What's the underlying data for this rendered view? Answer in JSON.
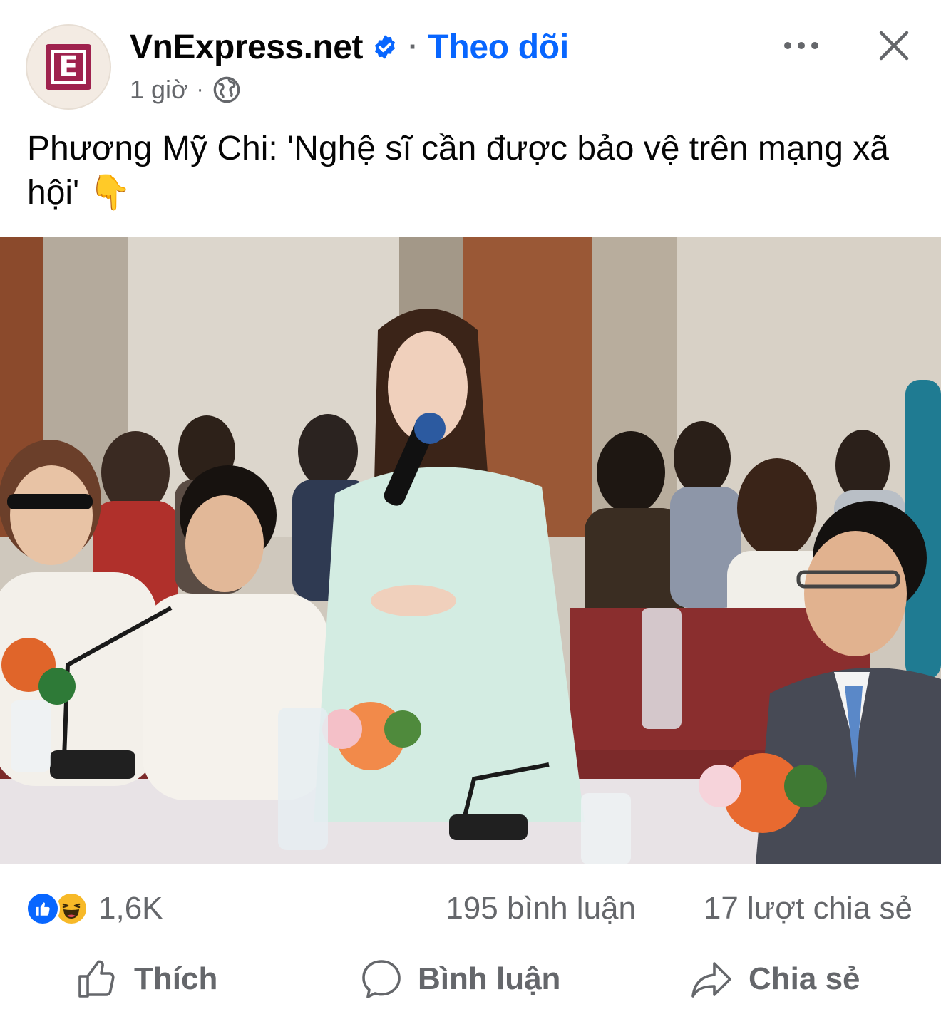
{
  "post": {
    "page_name": "VnExpress.net",
    "follow_label": "Theo dõi",
    "time": "1 giờ",
    "icons": {
      "avatar": "vnexpress-logo-icon",
      "verified": "verified-badge-icon",
      "audience": "globe-icon",
      "more": "more-horizontal-icon",
      "close": "close-icon"
    },
    "caption": "Phương Mỹ Chi: 'Nghệ sĩ cần được bảo vệ trên mạng xã hội' 👇",
    "colors": {
      "brand": "#9f224e",
      "accent": "#0866ff",
      "secondary_text": "#65676b"
    }
  },
  "stats": {
    "reaction_icons": [
      "like-reaction-icon",
      "haha-reaction-icon"
    ],
    "reactions_count": "1,6K",
    "comments": "195 bình luận",
    "shares": "17 lượt chia sẻ"
  },
  "actions": {
    "like": {
      "label": "Thích",
      "icon": "thumbs-up-icon"
    },
    "comment": {
      "label": "Bình luận",
      "icon": "comment-bubble-icon"
    },
    "share": {
      "label": "Chia sẻ",
      "icon": "share-arrow-icon"
    }
  }
}
